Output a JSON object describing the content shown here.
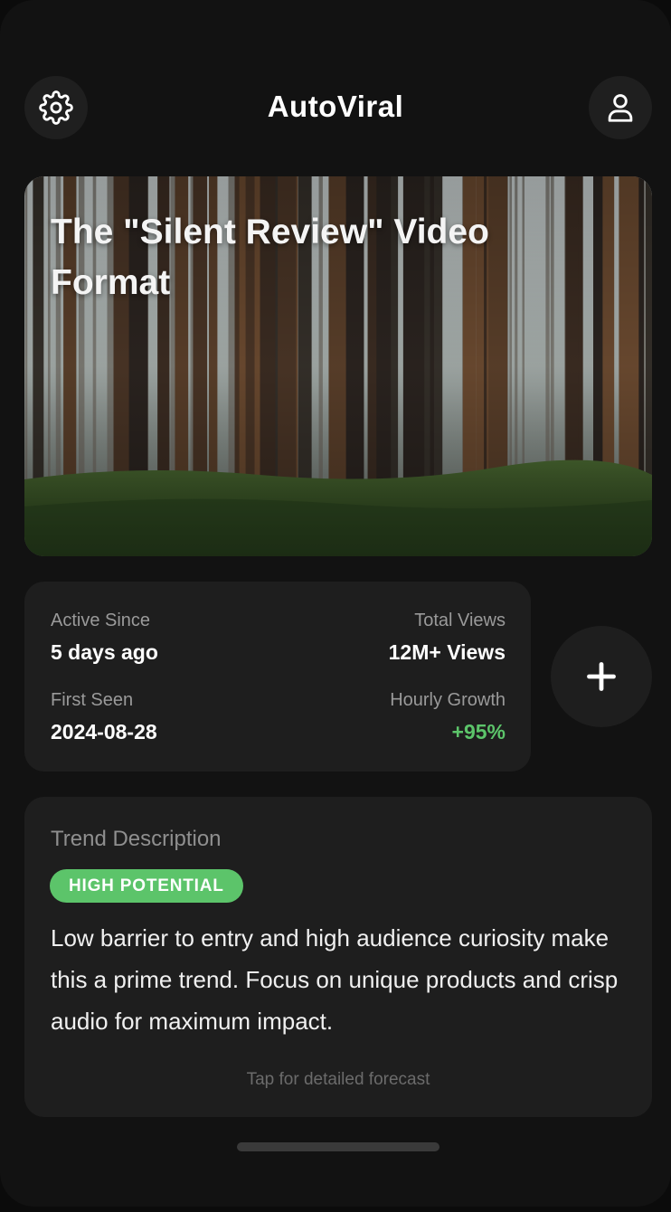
{
  "header": {
    "title": "AutoViral",
    "settings_icon": "gear-icon",
    "profile_icon": "user-icon"
  },
  "hero": {
    "title": "The \"Silent Review\" Video Format",
    "image": "pine-forest-photo"
  },
  "stats": {
    "active_since": {
      "label": "Active Since",
      "value": "5 days ago"
    },
    "total_views": {
      "label": "Total Views",
      "value": "12M+ Views"
    },
    "first_seen": {
      "label": "First Seen",
      "value": "2024-08-28"
    },
    "hourly_growth": {
      "label": "Hourly Growth",
      "value": "+95%"
    }
  },
  "add_button": {
    "icon": "plus-icon"
  },
  "trend": {
    "heading": "Trend Description",
    "badge": "HIGH POTENTIAL",
    "body": "Low barrier to entry and high audience curiosity make this a prime trend. Focus on unique products and crisp audio for maximum impact.",
    "hint": "Tap for detailed forecast"
  },
  "colors": {
    "background": "#121212",
    "card": "#1e1e1e",
    "accent_green": "#5cc46a",
    "muted_text": "#9a9a9a"
  }
}
